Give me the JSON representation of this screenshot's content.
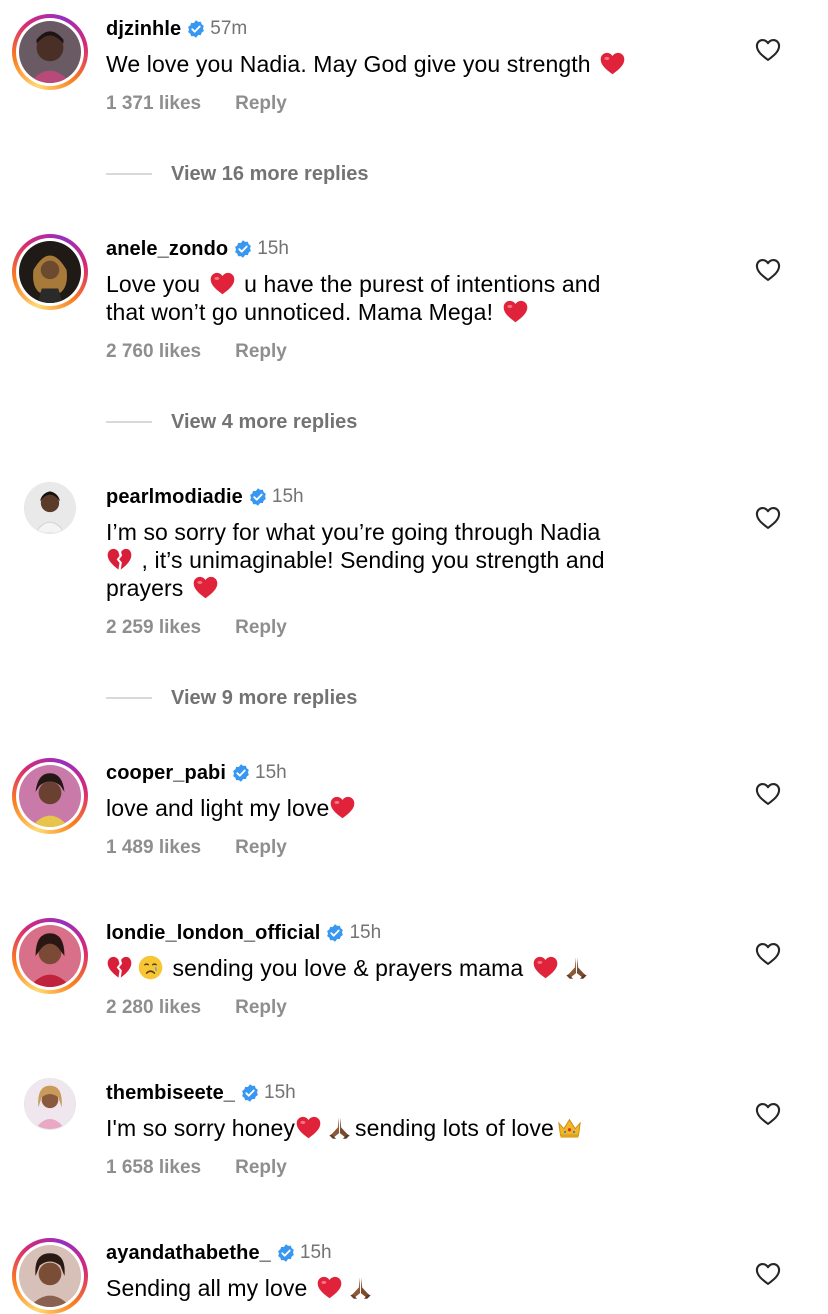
{
  "comments": [
    {
      "username": "djzinhle",
      "time": "57m",
      "text_parts": [
        "We love you Nadia. May God give you strength"
      ],
      "likes": "1 371 likes",
      "reply": "Reply",
      "view_replies": "View 16 more replies",
      "avatar_ring": "story",
      "emojis": [
        "red-heart"
      ]
    },
    {
      "username": "anele_zondo",
      "time": "15h",
      "text_parts": [
        "Love you",
        "u have the purest of intentions and",
        "that won’t go unnoticed. Mama Mega!"
      ],
      "likes": "2 760 likes",
      "reply": "Reply",
      "view_replies": "View 4 more replies",
      "avatar_ring": "story",
      "emojis": [
        "red-heart",
        "red-heart"
      ]
    },
    {
      "username": "pearlmodiadie",
      "time": "15h",
      "text_parts": [
        "I’m so sorry for what you’re going through Nadia",
        ", it’s unimaginable! Sending you strength and",
        "prayers"
      ],
      "likes": "2 259 likes",
      "reply": "Reply",
      "view_replies": "View 9 more replies",
      "avatar_ring": "none",
      "emojis": [
        "broken-heart",
        "red-heart"
      ]
    },
    {
      "username": "cooper_pabi",
      "time": "15h",
      "text_parts": [
        "love and light my love"
      ],
      "likes": "1 489 likes",
      "reply": "Reply",
      "avatar_ring": "story",
      "emojis": [
        "red-heart"
      ]
    },
    {
      "username": "londie_london_official",
      "time": "15h",
      "text_parts": [
        "sending you love & prayers mama"
      ],
      "likes": "2 280 likes",
      "reply": "Reply",
      "avatar_ring": "story",
      "emojis": [
        "broken-heart",
        "crying-face",
        "red-heart",
        "folded-hands"
      ]
    },
    {
      "username": "thembiseete_",
      "time": "15h",
      "text_parts": [
        "I'm so sorry honey",
        "sending lots of love"
      ],
      "likes": "1 658 likes",
      "reply": "Reply",
      "avatar_ring": "none",
      "emojis": [
        "red-heart",
        "folded-hands",
        "crown"
      ]
    },
    {
      "username": "ayandathabethe_",
      "time": "15h",
      "text_parts": [
        "Sending all my love"
      ],
      "avatar_ring": "story",
      "emojis": [
        "red-heart",
        "folded-hands"
      ]
    }
  ],
  "icons": {
    "verified_badge": "verified-badge-icon",
    "like": "heart-outline-icon"
  },
  "colors": {
    "verified": "#3897f0",
    "secondary_text": "#737373",
    "action_text": "#8e8e8e",
    "heart_emoji": "#e0223a",
    "divider": "#d9d9d9"
  }
}
